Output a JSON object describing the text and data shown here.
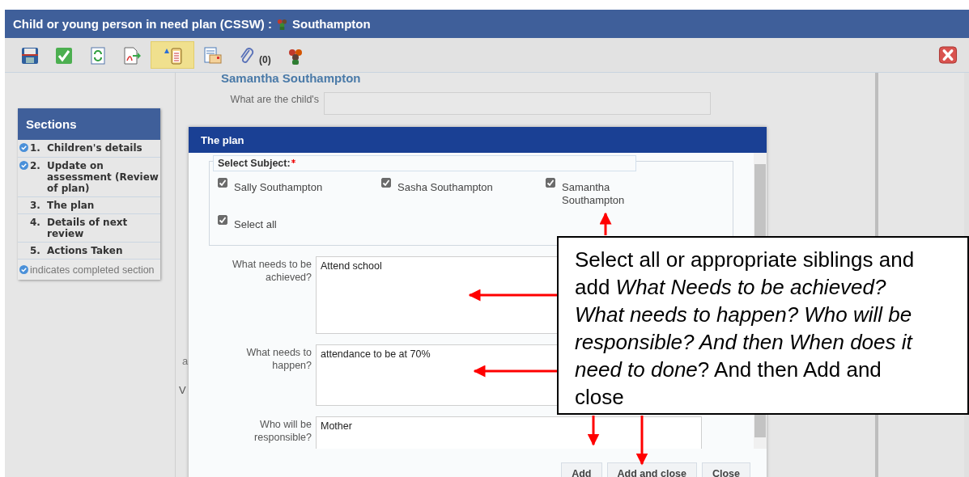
{
  "window": {
    "title": "Child or young person in need plan (CSSW) :",
    "subject": "Southampton"
  },
  "toolbar": {
    "tools": [
      {
        "kind": "save",
        "selected": false
      },
      {
        "kind": "complete",
        "selected": false
      },
      {
        "kind": "refresh",
        "selected": false
      },
      {
        "kind": "pdf",
        "selected": false
      },
      {
        "kind": "warnings",
        "selected": true
      },
      {
        "kind": "letter",
        "selected": false
      },
      {
        "kind": "attachments",
        "count": "(0)",
        "selected": false
      },
      {
        "kind": "people",
        "selected": false
      }
    ]
  },
  "form": {
    "person": "Samantha Southampton",
    "question": "What are the child's",
    "fragments": [
      "a",
      "V"
    ]
  },
  "sections": {
    "title": "Sections",
    "items": [
      {
        "number": "1.",
        "label": "Children's details",
        "completed": true
      },
      {
        "number": "2.",
        "label": "Update on assessment (Review of plan)",
        "completed": true
      },
      {
        "number": "3.",
        "label": "The plan",
        "completed": false
      },
      {
        "number": "4.",
        "label": "Details of next review",
        "completed": false
      },
      {
        "number": "5.",
        "label": "Actions Taken",
        "completed": false
      }
    ],
    "legend": "indicates completed section"
  },
  "dialog": {
    "title": "The plan",
    "subject_legend": "Select Subject:",
    "required": true,
    "subjects": [
      {
        "label": "Sally Southampton",
        "checked": true
      },
      {
        "label": "Sasha Southampton",
        "checked": true
      },
      {
        "label": "Samantha Southampton",
        "checked": true
      },
      {
        "label": "Select all",
        "checked": true
      }
    ],
    "fields": [
      {
        "label": "What needs to be achieved?",
        "value": "Attend school"
      },
      {
        "label": "What needs to happen?",
        "value": "attendance to be at 70%"
      },
      {
        "label": "Who will be responsible?",
        "value": "Mother"
      }
    ],
    "buttons": [
      "Add",
      "Add and close",
      "Close"
    ]
  },
  "callout": {
    "text": "Select all or appropriate siblings and add *What Needs to be achieved? What needs to happen? Who will be responsible? And then When does it need to done*? And then Add and close"
  }
}
